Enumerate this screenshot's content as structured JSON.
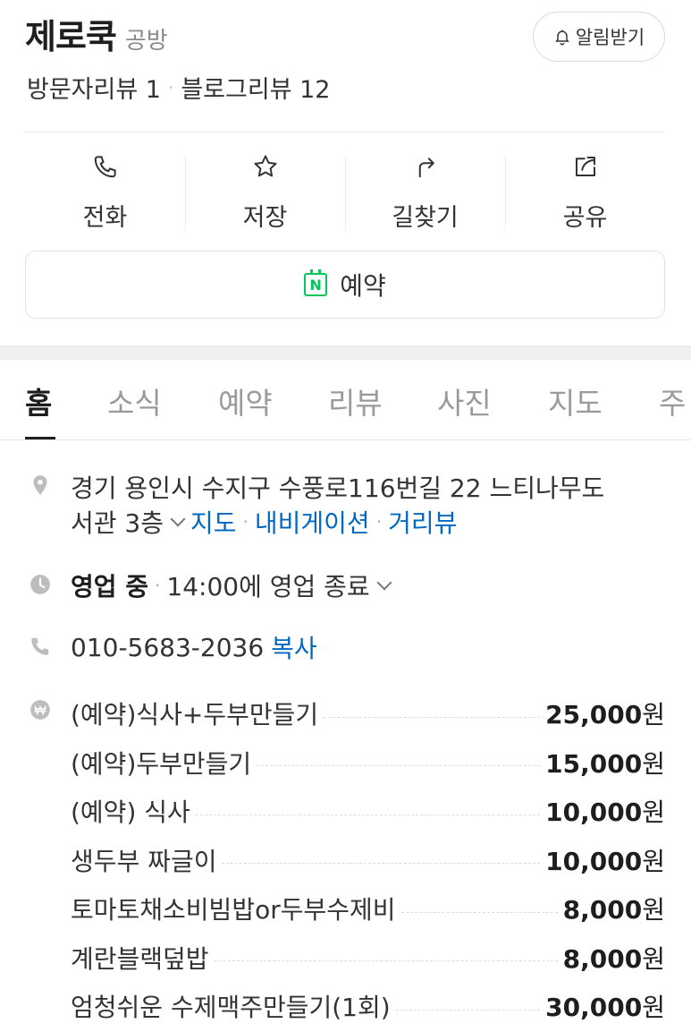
{
  "place": {
    "name": "제로쿡",
    "category": "공방",
    "notify_label": "알림받기",
    "visitor_reviews": "방문자리뷰 1",
    "blog_reviews": "블로그리뷰 12"
  },
  "actions": [
    {
      "label": "전화",
      "icon": "phone-icon"
    },
    {
      "label": "저장",
      "icon": "star-icon"
    },
    {
      "label": "길찾기",
      "icon": "directions-icon"
    },
    {
      "label": "공유",
      "icon": "share-icon"
    }
  ],
  "reserve_label": "예약",
  "tabs": [
    "홈",
    "소식",
    "예약",
    "리뷰",
    "사진",
    "지도",
    "주"
  ],
  "active_tab": "홈",
  "address": {
    "line1": "경기 용인시 수지구 수풍로116번길 22 느티나무도",
    "line2": "서관 3층",
    "map_link": "지도",
    "navigation_link": "내비게이션",
    "street_view_link": "거리뷰"
  },
  "hours": {
    "status": "영업 중",
    "detail": "14:00에 영업 종료"
  },
  "phone": {
    "number": "010-5683-2036",
    "copy_label": "복사"
  },
  "menu": [
    {
      "name": "(예약)식사+두부만들기",
      "price": "25,000",
      "unit": "원"
    },
    {
      "name": "(예약)두부만들기",
      "price": "15,000",
      "unit": "원"
    },
    {
      "name": "(예약) 식사",
      "price": "10,000",
      "unit": "원"
    },
    {
      "name": "생두부 짜글이",
      "price": "10,000",
      "unit": "원"
    },
    {
      "name": "토마토채소비빔밥or두부수제비",
      "price": "8,000",
      "unit": "원"
    },
    {
      "name": "계란블랙덮밥",
      "price": "8,000",
      "unit": "원"
    },
    {
      "name": "엄청쉬운 수제맥주만들기(1회)",
      "price": "30,000",
      "unit": "원"
    }
  ],
  "colors": {
    "link": "#0068c3",
    "naver_green": "#03c75a",
    "muted": "#8a8a8a"
  }
}
